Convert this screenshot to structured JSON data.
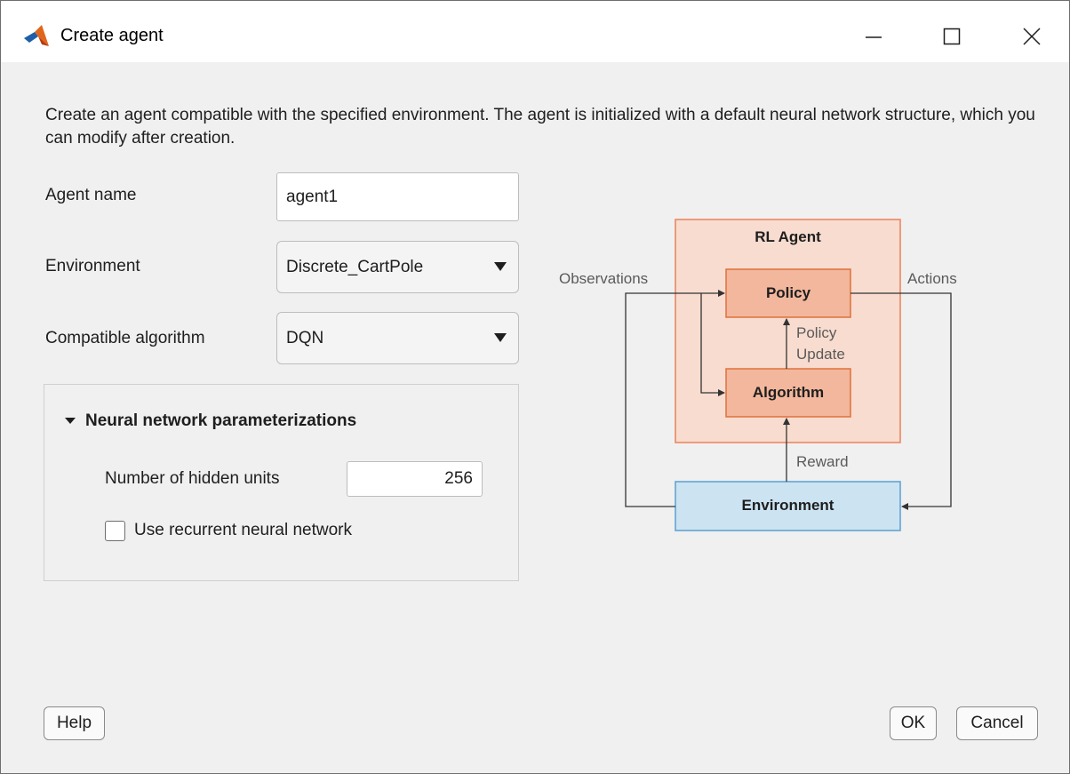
{
  "window": {
    "title": "Create agent",
    "icon": "matlab-logo-icon",
    "controls": [
      "minimize-icon",
      "maximize-icon",
      "close-icon"
    ]
  },
  "description": "Create an agent compatible with the specified environment. The agent is initialized with a default neural network structure, which you can modify after creation.",
  "form": {
    "agent_name_label": "Agent name",
    "agent_name_value": "agent1",
    "environment_label": "Environment",
    "environment_value": "Discrete_CartPole",
    "algorithm_label": "Compatible algorithm",
    "algorithm_value": "DQN"
  },
  "nn_panel": {
    "title": "Neural network parameterizations",
    "hidden_units_label": "Number of hidden units",
    "hidden_units_value": "256",
    "recurrent_label": "Use recurrent neural network",
    "recurrent_checked": false
  },
  "diagram": {
    "agent_box": "RL Agent",
    "policy": "Policy",
    "algorithm": "Algorithm",
    "environment": "Environment",
    "observations": "Observations",
    "actions": "Actions",
    "policy_update_1": "Policy",
    "policy_update_2": "Update",
    "reward": "Reward",
    "colors": {
      "agent_fill": "#f8dccf",
      "agent_stroke": "#e8825a",
      "block_fill": "#f2b79c",
      "env_fill": "#cce3f2",
      "env_stroke": "#5aa0d0"
    }
  },
  "buttons": {
    "help": "Help",
    "ok": "OK",
    "cancel": "Cancel"
  }
}
